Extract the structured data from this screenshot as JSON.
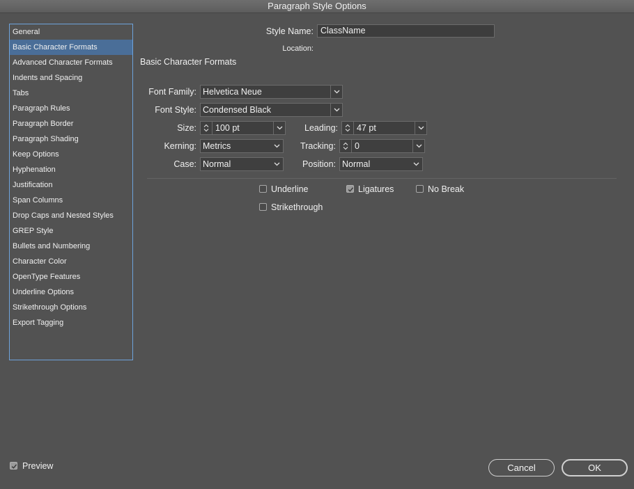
{
  "window": {
    "title": "Paragraph Style Options"
  },
  "sidebar": {
    "items": [
      {
        "label": "General"
      },
      {
        "label": "Basic Character Formats",
        "selected": true
      },
      {
        "label": "Advanced Character Formats"
      },
      {
        "label": "Indents and Spacing"
      },
      {
        "label": "Tabs"
      },
      {
        "label": "Paragraph Rules"
      },
      {
        "label": "Paragraph Border"
      },
      {
        "label": "Paragraph Shading"
      },
      {
        "label": "Keep Options"
      },
      {
        "label": "Hyphenation"
      },
      {
        "label": "Justification"
      },
      {
        "label": "Span Columns"
      },
      {
        "label": "Drop Caps and Nested Styles"
      },
      {
        "label": "GREP Style"
      },
      {
        "label": "Bullets and Numbering"
      },
      {
        "label": "Character Color"
      },
      {
        "label": "OpenType Features"
      },
      {
        "label": "Underline Options"
      },
      {
        "label": "Strikethrough Options"
      },
      {
        "label": "Export Tagging"
      }
    ]
  },
  "style_name": {
    "label": "Style Name:",
    "value": "ClassName"
  },
  "location": {
    "label": "Location:"
  },
  "section": {
    "heading": "Basic Character Formats"
  },
  "fields": {
    "font_family": {
      "label": "Font Family:",
      "value": "Helvetica Neue"
    },
    "font_style": {
      "label": "Font Style:",
      "value": "Condensed Black"
    },
    "size": {
      "label": "Size:",
      "value": "100 pt"
    },
    "leading": {
      "label": "Leading:",
      "value": "47 pt"
    },
    "kerning": {
      "label": "Kerning:",
      "value": "Metrics"
    },
    "tracking": {
      "label": "Tracking:",
      "value": "0"
    },
    "case": {
      "label": "Case:",
      "value": "Normal"
    },
    "position": {
      "label": "Position:",
      "value": "Normal"
    }
  },
  "options": {
    "underline": {
      "label": "Underline",
      "checked": false
    },
    "ligatures": {
      "label": "Ligatures",
      "checked": true
    },
    "no_break": {
      "label": "No Break",
      "checked": false
    },
    "strikethrough": {
      "label": "Strikethrough",
      "checked": false
    }
  },
  "footer": {
    "preview": {
      "label": "Preview",
      "checked": true
    },
    "cancel_label": "Cancel",
    "ok_label": "OK"
  },
  "colors": {
    "background": "#525252",
    "selection": "#4a6e98",
    "sidebar_border": "#6ea3dc"
  }
}
